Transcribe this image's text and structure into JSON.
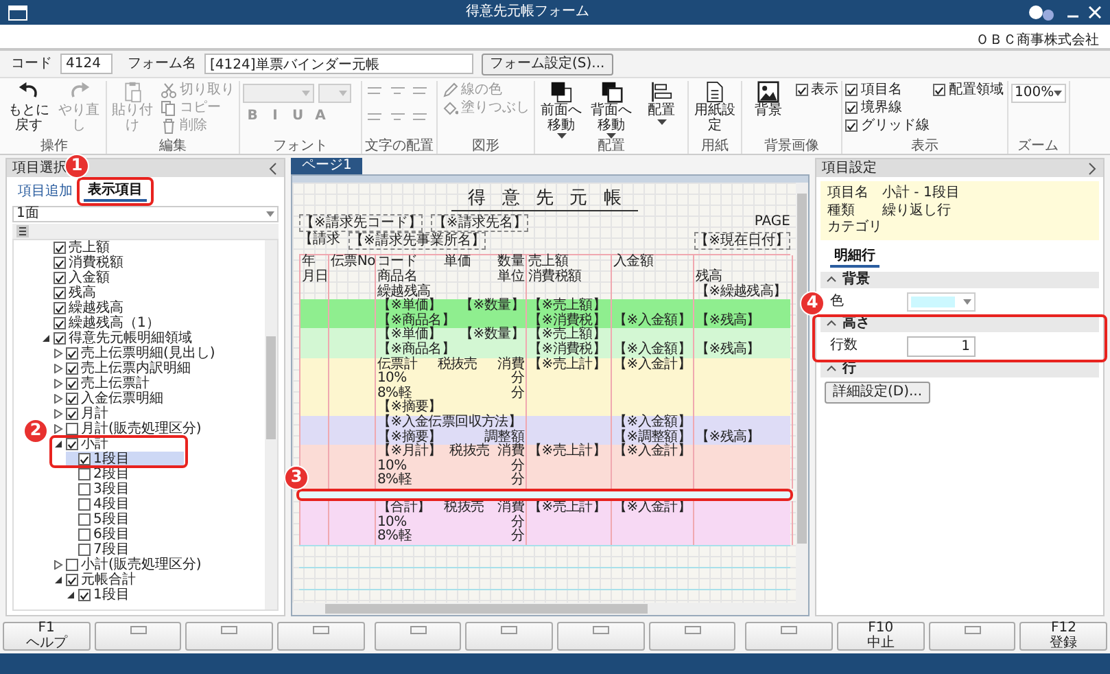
{
  "window": {
    "title": "得意先元帳フォーム",
    "company": "ＯＢＣ商事株式会社"
  },
  "form": {
    "code_label": "コード",
    "code": "4124",
    "name_label": "フォーム名",
    "name": "[4124]単票バインダー元帳",
    "settings_button": "フォーム設定(S)..."
  },
  "ribbon": [
    {
      "label": "操作",
      "items": [
        {
          "kind": "big",
          "label": "もとに戻す",
          "disabled": false
        },
        {
          "kind": "big",
          "label": "やり直し",
          "disabled": true
        }
      ]
    },
    {
      "label": "編集",
      "items": [
        {
          "kind": "big",
          "label": "貼り付け",
          "disabled": true
        },
        {
          "kind": "small",
          "label": "切り取り",
          "disabled": true
        },
        {
          "kind": "small",
          "label": "コピー",
          "disabled": true
        },
        {
          "kind": "small",
          "label": "削除",
          "disabled": true
        }
      ]
    },
    {
      "label": "フォント",
      "items": [
        {
          "kind": "select",
          "disabled": true
        },
        {
          "kind": "select",
          "disabled": true
        },
        {
          "kind": "glyph",
          "label": "B",
          "disabled": true
        },
        {
          "kind": "glyph",
          "label": "I",
          "disabled": true
        },
        {
          "kind": "glyph",
          "label": "U",
          "disabled": true
        },
        {
          "kind": "glyph",
          "label": "A",
          "disabled": true
        }
      ]
    },
    {
      "label": "文字の配置",
      "items": [
        {
          "kind": "icon",
          "disabled": true
        },
        {
          "kind": "icon",
          "disabled": true
        },
        {
          "kind": "icon",
          "disabled": true
        },
        {
          "kind": "icon",
          "disabled": true
        },
        {
          "kind": "icon",
          "disabled": true
        },
        {
          "kind": "icon",
          "disabled": true
        }
      ]
    },
    {
      "label": "図形",
      "items": [
        {
          "kind": "small",
          "label": "線の色",
          "disabled": true
        },
        {
          "kind": "small",
          "label": "塗りつぶし",
          "disabled": true
        }
      ]
    },
    {
      "label": "配置",
      "items": [
        {
          "kind": "big",
          "label": "前面へ移動",
          "disabled": false,
          "dropdown": true
        },
        {
          "kind": "big",
          "label": "背面へ移動",
          "disabled": false,
          "dropdown": true
        },
        {
          "kind": "big",
          "label": "配置",
          "disabled": false,
          "dropdown": true
        }
      ]
    },
    {
      "label": "用紙",
      "items": [
        {
          "kind": "big",
          "label": "用紙設定",
          "disabled": false
        }
      ]
    },
    {
      "label": "背景画像",
      "items": [
        {
          "kind": "big",
          "label": "背景",
          "disabled": false
        },
        {
          "kind": "check",
          "label": "表示",
          "checked": true
        }
      ]
    },
    {
      "label": "表示",
      "items": [
        {
          "kind": "check",
          "label": "項目名",
          "checked": true
        },
        {
          "kind": "check",
          "label": "境界線",
          "checked": true
        },
        {
          "kind": "check",
          "label": "グリッド線",
          "checked": true
        },
        {
          "kind": "check",
          "label": "配置領域",
          "checked": true
        }
      ]
    },
    {
      "label": "ズーム",
      "items": [
        {
          "kind": "select",
          "value": "100%",
          "disabled": false
        }
      ]
    }
  ],
  "left_panel": {
    "title": "項目選択",
    "tabs": [
      {
        "label": "項目追加",
        "selected": false
      },
      {
        "label": "表示項目",
        "selected": true
      }
    ],
    "page_select": "1面",
    "tree": [
      {
        "label": "売上額",
        "checked": true,
        "selected": false
      },
      {
        "label": "消費税額",
        "checked": true,
        "selected": false
      },
      {
        "label": "入金額",
        "checked": true,
        "selected": false
      },
      {
        "label": "残高",
        "checked": true,
        "selected": false
      },
      {
        "label": "繰越残高",
        "checked": true,
        "selected": false
      },
      {
        "label": "繰越残高（1）",
        "checked": true,
        "selected": false
      },
      {
        "label": "得意先元帳明細領域",
        "checked": true,
        "selected": false,
        "expanded": true,
        "children": [
          {
            "label": "売上伝票明細(見出し)",
            "checked": true,
            "selected": false,
            "expanded": false
          },
          {
            "label": "売上伝票内訳明細",
            "checked": true,
            "selected": false,
            "expanded": false
          },
          {
            "label": "売上伝票計",
            "checked": true,
            "selected": false,
            "expanded": false
          },
          {
            "label": "入金伝票明細",
            "checked": true,
            "selected": false,
            "expanded": false
          },
          {
            "label": "月計",
            "checked": true,
            "selected": false,
            "expanded": false
          },
          {
            "label": "月計(販売処理区分)",
            "checked": false,
            "selected": false,
            "expanded": false
          },
          {
            "label": "小計",
            "checked": true,
            "selected": false,
            "expanded": true,
            "children": [
              {
                "label": "1段目",
                "checked": true,
                "selected": true
              },
              {
                "label": "2段目",
                "checked": false,
                "selected": false
              },
              {
                "label": "3段目",
                "checked": false,
                "selected": false
              },
              {
                "label": "4段目",
                "checked": false,
                "selected": false
              },
              {
                "label": "5段目",
                "checked": false,
                "selected": false
              },
              {
                "label": "6段目",
                "checked": false,
                "selected": false
              },
              {
                "label": "7段目",
                "checked": false,
                "selected": false
              }
            ]
          },
          {
            "label": "小計(販売処理区分)",
            "checked": false,
            "selected": false,
            "expanded": false
          },
          {
            "label": "元帳合計",
            "checked": true,
            "selected": false,
            "expanded": true,
            "children": [
              {
                "label": "1段目",
                "checked": true,
                "selected": false,
                "expanded": true
              }
            ]
          }
        ]
      }
    ]
  },
  "canvas": {
    "pages": [
      {
        "label": "ページ1",
        "selected": true
      }
    ],
    "title": "得意先元帳",
    "header_lines": [
      [
        {
          "text": "【※請求先コード】",
          "kind": "field"
        },
        {
          "text": "【※請求先名】",
          "kind": "field"
        },
        {
          "text": "PAGE",
          "kind": "label"
        }
      ],
      [
        {
          "text": "【請求",
          "kind": "label"
        },
        {
          "text": "【※請求先事業所名】",
          "kind": "field"
        },
        {
          "text": "【※現在日付】",
          "kind": "field"
        }
      ]
    ],
    "table_header": [
      {
        "date": [
          "年"
        ],
        "slip": [
          "伝票No"
        ],
        "item": [
          "コード",
          "単価",
          "数量"
        ],
        "sales": [
          "売上額"
        ],
        "deposit": [
          "入金額"
        ]
      },
      {
        "date": [
          "月日"
        ],
        "item": [
          "商品名",
          "単位"
        ],
        "sales": [
          "消費税額"
        ],
        "balance": [
          "残高"
        ]
      },
      {
        "item": [
          "繰越残高"
        ],
        "balance": [
          "【※繰越残高】"
        ]
      }
    ],
    "bands": [
      {
        "color": "#8fee8f",
        "selected": false,
        "lines": [
          {
            "item": [
              "【※単価】",
              "【※数量】"
            ],
            "sales": [
              "【※売上額】"
            ]
          },
          {
            "item": [
              "【※商品名】"
            ],
            "sales": [
              "【※消費税】"
            ],
            "deposit": [
              "【※入金額】"
            ],
            "balance": [
              "【※残高】"
            ]
          }
        ]
      },
      {
        "color": "#d3f7d3",
        "selected": false,
        "lines": [
          {
            "item": [
              "【※単価】",
              "【※数量】"
            ],
            "sales": [
              "【※売上額】"
            ]
          },
          {
            "item": [
              "【※商品名】"
            ],
            "sales": [
              "【※消費税】"
            ],
            "deposit": [
              "【※入金額】"
            ],
            "balance": [
              "【※残高】"
            ]
          }
        ]
      },
      {
        "color": "#fdf6cf",
        "selected": false,
        "lines": [
          {
            "item": [
              "伝票計",
              "税抜売",
              "消費"
            ],
            "sales": [
              "【※売上計】"
            ],
            "deposit": [
              "【※入金計】"
            ]
          },
          {
            "item": [
              "10%",
              "分"
            ]
          },
          {
            "item": [
              "8%軽",
              "分"
            ]
          },
          {
            "item": [
              "【※摘要】"
            ]
          }
        ]
      },
      {
        "color": "#dedcf6",
        "selected": false,
        "lines": [
          {
            "item": [
              "【※入金伝票回収方法】"
            ],
            "deposit": [
              "【※入金額】"
            ]
          },
          {
            "item": [
              "【※摘要】",
              "調整額"
            ],
            "deposit": [
              "【※調整額】"
            ],
            "balance": [
              "【※残高】"
            ]
          }
        ]
      },
      {
        "color": "#fbdcd6",
        "selected": false,
        "lines": [
          {
            "item": [
              "【※月計】",
              "税抜売",
              "消費"
            ],
            "sales": [
              "【※売上計】"
            ],
            "deposit": [
              "【※入金計】"
            ]
          },
          {
            "item": [
              "10%",
              "分"
            ]
          },
          {
            "item": [
              "8%軽",
              "分"
            ]
          }
        ]
      },
      {
        "color": "#e4f8fa",
        "selected": true
      },
      {
        "color": "#f7d9f4",
        "selected": false,
        "lines": [
          {
            "item": [
              "【合計】",
              "税抜売",
              "消費"
            ],
            "sales": [
              "【※売上計】"
            ],
            "deposit": [
              "【※入金計】"
            ]
          },
          {
            "item": [
              "10%",
              "分"
            ]
          },
          {
            "item": [
              "8%軽",
              "分"
            ]
          }
        ]
      }
    ]
  },
  "right_panel": {
    "title": "項目設定",
    "info": [
      {
        "label": "項目名",
        "value": "小計 - 1段目"
      },
      {
        "label": "種類",
        "value": "繰り返し行"
      },
      {
        "label": "カテゴリ"
      }
    ],
    "tabs": [
      {
        "label": "明細行",
        "selected": true
      }
    ],
    "sections": [
      {
        "title": "背景",
        "expanded": true,
        "rows": [
          {
            "kind": "color",
            "label": "色",
            "color": "#ccf8ff"
          }
        ]
      },
      {
        "title": "高さ",
        "expanded": true,
        "rows": [
          {
            "kind": "number",
            "label": "行数",
            "value": "1"
          }
        ]
      },
      {
        "title": "行",
        "expanded": true,
        "rows": [
          {
            "kind": "button",
            "label": "詳細設定(D)..."
          }
        ]
      }
    ]
  },
  "function_keys": [
    {
      "kind": "key",
      "key": "F1",
      "label": "ヘルプ"
    },
    {
      "kind": "blank"
    },
    {
      "kind": "blank"
    },
    {
      "kind": "blank"
    },
    {
      "kind": "blank"
    },
    {
      "kind": "blank"
    },
    {
      "kind": "blank"
    },
    {
      "kind": "blank"
    },
    {
      "kind": "blank"
    },
    {
      "kind": "key",
      "key": "F10",
      "label": "中止"
    },
    {
      "kind": "blank"
    },
    {
      "kind": "key",
      "key": "F12",
      "label": "登録"
    }
  ],
  "callouts": [
    {
      "label": "1"
    },
    {
      "label": "2"
    },
    {
      "label": "3"
    },
    {
      "label": "4"
    }
  ]
}
